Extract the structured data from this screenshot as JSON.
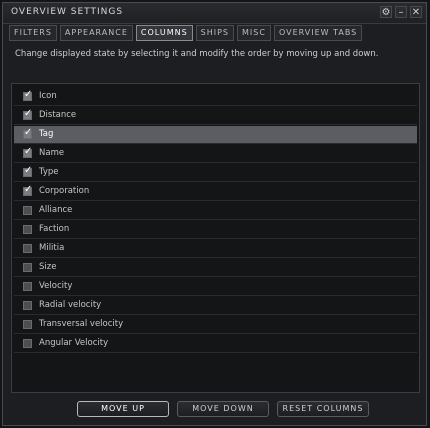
{
  "window": {
    "title": "OVERVIEW SETTINGS",
    "controls": {
      "options": "⚙",
      "minimize": "–",
      "close": "✕"
    }
  },
  "tabs": [
    {
      "label": "FILTERS",
      "active": false
    },
    {
      "label": "APPEARANCE",
      "active": false
    },
    {
      "label": "COLUMNS",
      "active": true
    },
    {
      "label": "SHIPS",
      "active": false
    },
    {
      "label": "MISC",
      "active": false
    },
    {
      "label": "OVERVIEW TABS",
      "active": false
    }
  ],
  "description": "Change displayed state by selecting it and modify the order by moving up and down.",
  "columns": [
    {
      "label": "Icon",
      "checked": true,
      "selected": false
    },
    {
      "label": "Distance",
      "checked": true,
      "selected": false
    },
    {
      "label": "Tag",
      "checked": true,
      "selected": true
    },
    {
      "label": "Name",
      "checked": true,
      "selected": false
    },
    {
      "label": "Type",
      "checked": true,
      "selected": false
    },
    {
      "label": "Corporation",
      "checked": true,
      "selected": false
    },
    {
      "label": "Alliance",
      "checked": false,
      "selected": false
    },
    {
      "label": "Faction",
      "checked": false,
      "selected": false
    },
    {
      "label": "Militia",
      "checked": false,
      "selected": false
    },
    {
      "label": "Size",
      "checked": false,
      "selected": false
    },
    {
      "label": "Velocity",
      "checked": false,
      "selected": false
    },
    {
      "label": "Radial velocity",
      "checked": false,
      "selected": false
    },
    {
      "label": "Transversal velocity",
      "checked": false,
      "selected": false
    },
    {
      "label": "Angular Velocity",
      "checked": false,
      "selected": false
    }
  ],
  "buttons": {
    "move_up": "MOVE UP",
    "move_down": "MOVE DOWN",
    "reset": "RESET COLUMNS"
  }
}
